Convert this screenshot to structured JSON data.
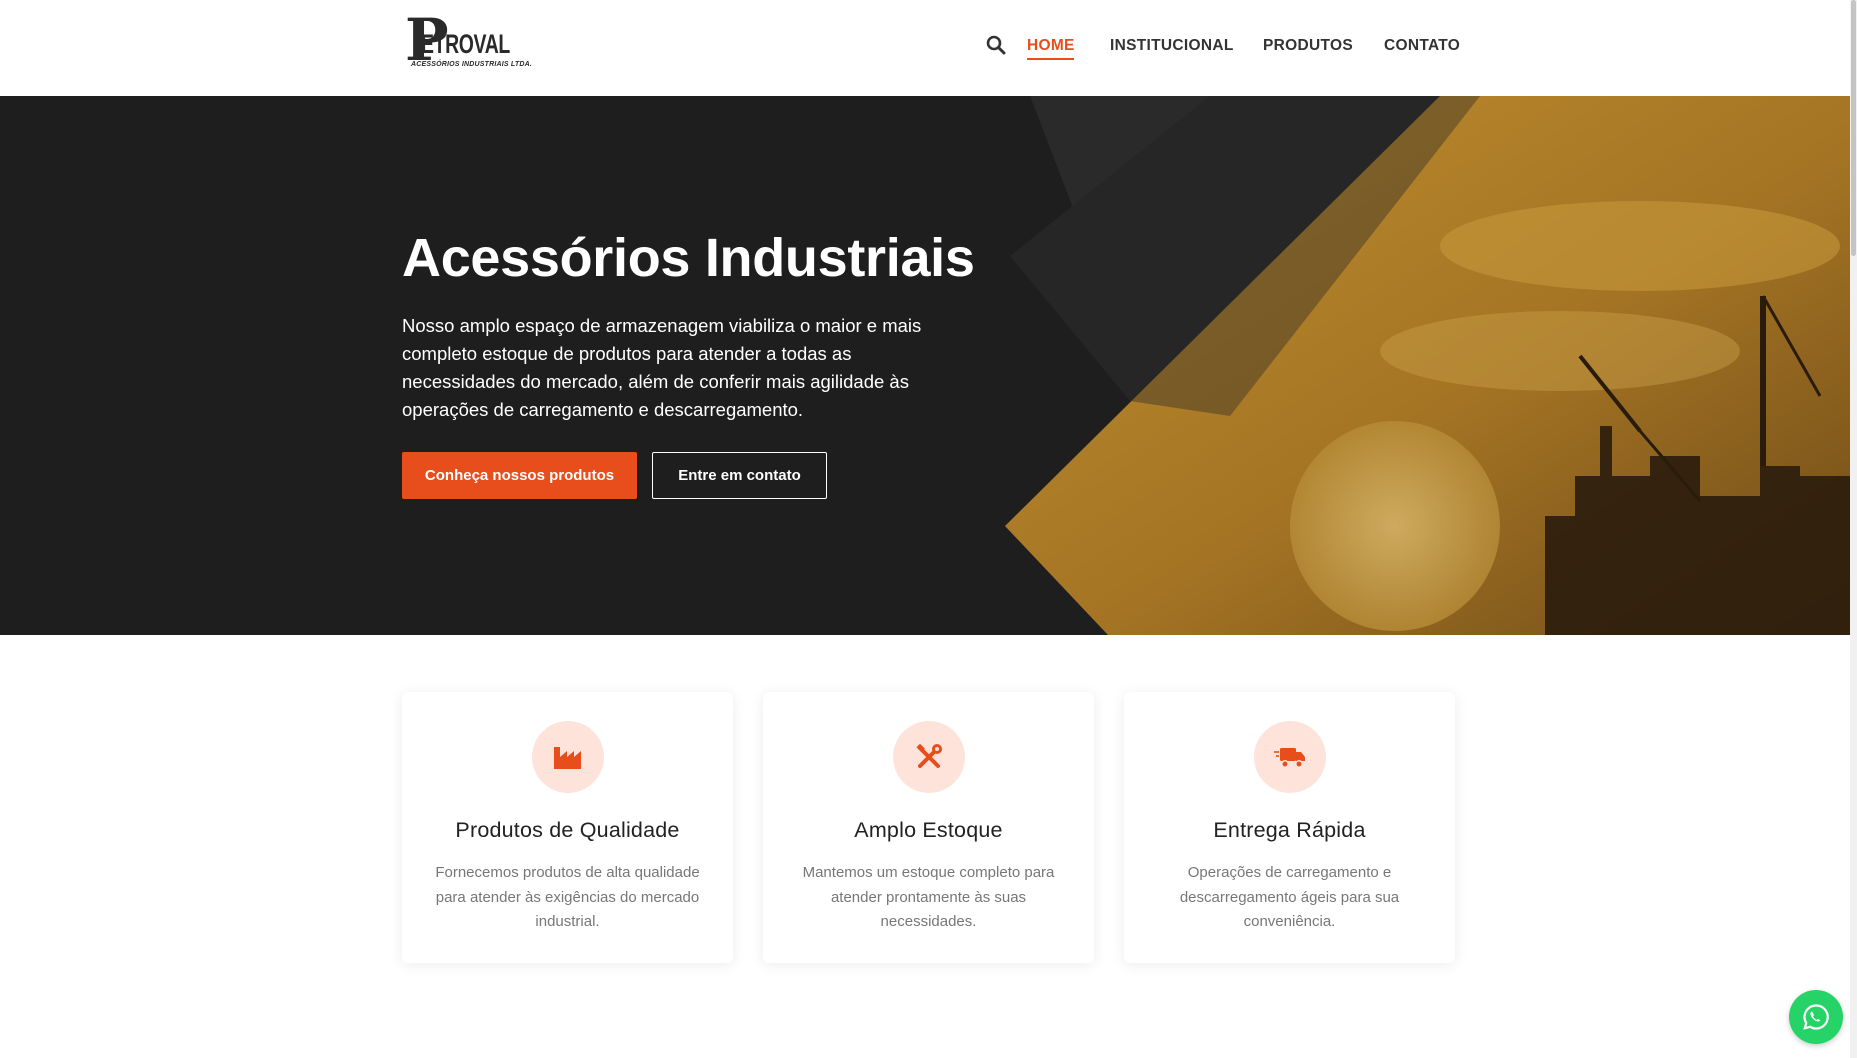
{
  "header": {
    "logo": {
      "mark": "P",
      "name": "ETROVAL",
      "tagline": "ACESSÓRIOS INDUSTRIAIS LTDA."
    },
    "nav": [
      {
        "label": "HOME",
        "active": true
      },
      {
        "label": "INSTITUCIONAL",
        "active": false
      },
      {
        "label": "PRODUTOS",
        "active": false
      },
      {
        "label": "CONTATO",
        "active": false
      }
    ]
  },
  "hero": {
    "title": "Acessórios Industriais",
    "text": "Nosso amplo espaço de armazenagem viabiliza o maior e mais completo estoque de produtos para atender a todas as necessidades do mercado, além de conferir mais agilidade às operações de carregamento e descarregamento.",
    "primary_button": "Conheça nossos produtos",
    "secondary_button": "Entre em contato"
  },
  "features": [
    {
      "icon": "factory-icon",
      "title": "Produtos de Qualidade",
      "text": "Fornecemos produtos de alta qualidade para atender às exigências do mercado industrial."
    },
    {
      "icon": "tools-icon",
      "title": "Amplo Estoque",
      "text": "Mantemos um estoque completo para atender prontamente às suas necessidades."
    },
    {
      "icon": "shipping-truck-icon",
      "title": "Entrega Rápida",
      "text": "Operações de carregamento e descarregamento ágeis para sua conveniência."
    }
  ],
  "colors": {
    "accent": "#e84e1b",
    "hero_background": "#1e1e1e",
    "gold": "#b98a2c",
    "icon_circle": "#fde3da",
    "whatsapp": "#25d366"
  }
}
